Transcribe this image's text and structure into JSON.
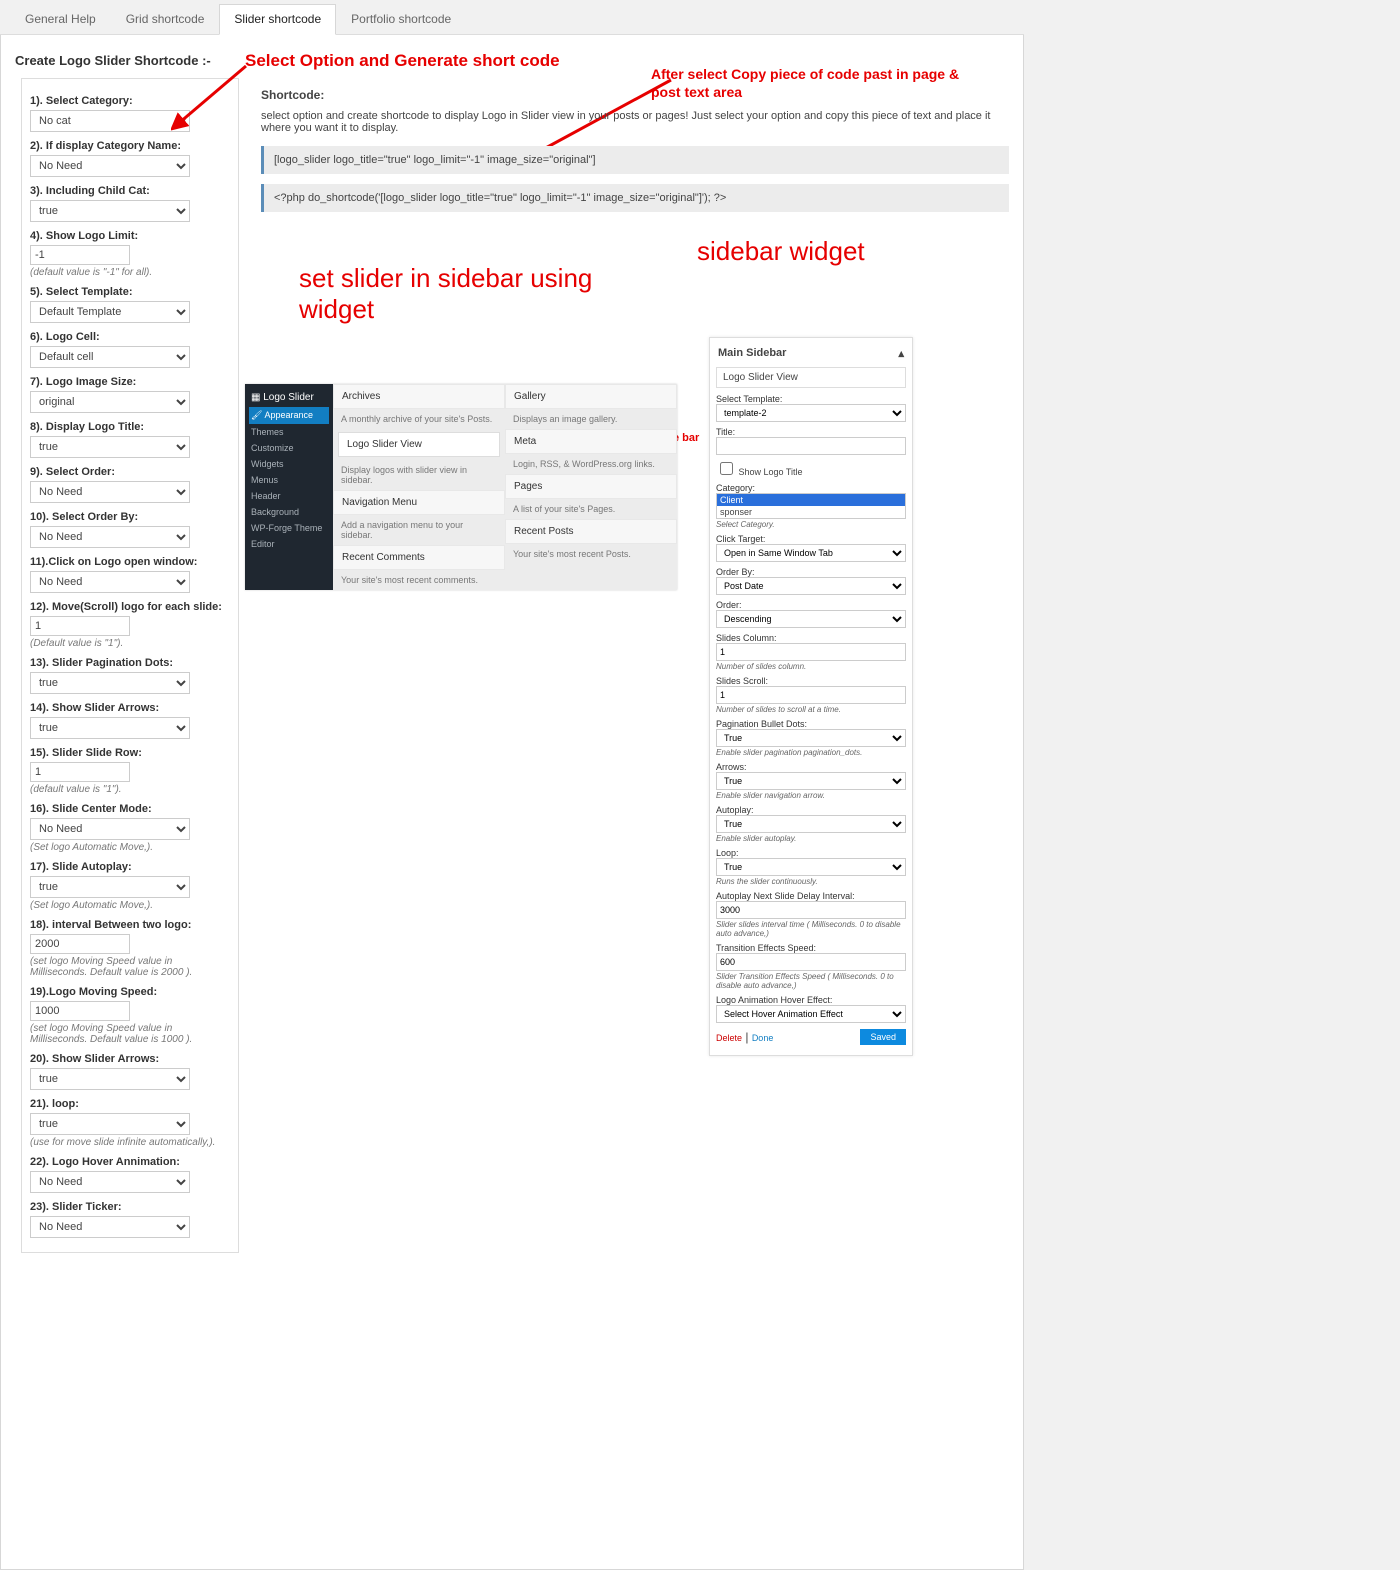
{
  "tabs": {
    "t0": "General Help",
    "t1": "Grid shortcode",
    "t2": "Slider shortcode",
    "t3": "Portfolio shortcode"
  },
  "page_title": "Create Logo Slider Shortcode :-",
  "annotations": {
    "a1": "Select Option and Generate short code",
    "a2": "After select Copy piece of code past in page & post text area",
    "a3": "set slider in sidebar using widget",
    "a4": "sidebar widget",
    "a5": "Select widget for side bar"
  },
  "shortcode_panel": {
    "title": "Shortcode:",
    "desc": "select option and create shortcode to display Logo in Slider view in your posts or pages! Just select your option and copy this piece of text and place it where you want it to display.",
    "code1": "[logo_slider logo_title=\"true\" logo_limit=\"-1\" image_size=\"original\"]",
    "code2": "<?php do_shortcode('[logo_slider logo_title=\"true\" logo_limit=\"-1\" image_size=\"original\"]'); ?>"
  },
  "fields": {
    "f1": {
      "label": "1). Select Category:",
      "value": "No cat",
      "type": "select"
    },
    "f2": {
      "label": "2). If display Category Name:",
      "value": "No Need",
      "type": "select"
    },
    "f3": {
      "label": "3). Including Child Cat:",
      "value": "true",
      "type": "select"
    },
    "f4": {
      "label": "4). Show Logo Limit:",
      "value": "-1",
      "type": "input-small",
      "help": "(default value is \"-1\" for all)."
    },
    "f5": {
      "label": "5). Select Template:",
      "value": "Default Template",
      "type": "select"
    },
    "f6": {
      "label": "6). Logo Cell:",
      "value": "Default cell",
      "type": "select"
    },
    "f7": {
      "label": "7). Logo Image Size:",
      "value": "original",
      "type": "select"
    },
    "f8": {
      "label": "8). Display Logo Title:",
      "value": "true",
      "type": "select"
    },
    "f9": {
      "label": "9). Select Order:",
      "value": "No Need",
      "type": "select"
    },
    "f10": {
      "label": "10). Select Order By:",
      "value": "No Need",
      "type": "select"
    },
    "f11": {
      "label": "11).Click on Logo open window:",
      "value": "No Need",
      "type": "select"
    },
    "f12": {
      "label": "12). Move(Scroll) logo for each slide:",
      "value": "1",
      "type": "input-small",
      "help": "(Default value is \"1\")."
    },
    "f13": {
      "label": "13). Slider Pagination Dots:",
      "value": "true",
      "type": "select"
    },
    "f14": {
      "label": "14). Show Slider Arrows:",
      "value": "true",
      "type": "select"
    },
    "f15": {
      "label": "15). Slider Slide Row:",
      "value": "1",
      "type": "input-small",
      "help": "(default value is \"1\")."
    },
    "f16": {
      "label": "16). Slide Center Mode:",
      "value": "No Need",
      "type": "select",
      "help": "(Set logo Automatic Move,)."
    },
    "f17": {
      "label": "17). Slide Autoplay:",
      "value": "true",
      "type": "select",
      "help": "(Set logo Automatic Move,)."
    },
    "f18": {
      "label": "18). interval Between two logo:",
      "value": "2000",
      "type": "input-small",
      "help": "(set logo Moving Speed value in Milliseconds. Default value is 2000 )."
    },
    "f19": {
      "label": "19).Logo Moving Speed:",
      "value": "1000",
      "type": "input-small",
      "help": "(set logo Moving Speed value in Milliseconds. Default value is 1000 )."
    },
    "f20": {
      "label": "20). Show Slider Arrows:",
      "value": "true",
      "type": "select"
    },
    "f21": {
      "label": "21). loop:",
      "value": "true",
      "type": "select",
      "help": "(use for move slide infinite automatically,)."
    },
    "f22": {
      "label": "22). Logo Hover Annimation:",
      "value": "No Need",
      "type": "select"
    },
    "f23": {
      "label": "23). Slider Ticker:",
      "value": "No Need",
      "type": "select"
    }
  },
  "widget_chooser": {
    "brand": "Logo Slider",
    "side_active": "Appearance",
    "side_items": [
      "Themes",
      "Customize",
      "Widgets",
      "Menus",
      "Header",
      "Background",
      "WP-Forge Theme",
      "Editor"
    ],
    "col1": [
      {
        "h": "Archives",
        "d": "A monthly archive of your site's Posts."
      },
      {
        "h": "Logo Slider View",
        "d": "Display logos with slider view in sidebar.",
        "widget": true
      },
      {
        "h": "Navigation Menu",
        "d": "Add a navigation menu to your sidebar."
      },
      {
        "h": "Recent Comments",
        "d": "Your site's most recent comments."
      }
    ],
    "col2": [
      {
        "h": "Gallery",
        "d": "Displays an image gallery."
      },
      {
        "h": "Meta",
        "d": "Login, RSS, & WordPress.org links."
      },
      {
        "h": "Pages",
        "d": "A list of your site's Pages."
      },
      {
        "h": "Recent Posts",
        "d": "Your site's most recent Posts."
      }
    ]
  },
  "widget_form": {
    "header": "Main Sidebar",
    "sub": "Logo Slider View",
    "template_lbl": "Select Template:",
    "template_val": "template-2",
    "title_lbl": "Title:",
    "title_val": "",
    "show_title": "Show Logo Title",
    "cat_lbl": "Category:",
    "cat_opts": [
      "Client",
      "sponser"
    ],
    "cat_help": "Select Category.",
    "click_lbl": "Click Target:",
    "click_val": "Open in Same Window Tab",
    "orderby_lbl": "Order By:",
    "orderby_val": "Post Date",
    "order_lbl": "Order:",
    "order_val": "Descending",
    "col_lbl": "Slides Column:",
    "col_val": "1",
    "col_help": "Number of slides column.",
    "scroll_lbl": "Slides Scroll:",
    "scroll_val": "1",
    "scroll_help": "Number of slides to scroll at a time.",
    "dots_lbl": "Pagination Bullet Dots:",
    "dots_val": "True",
    "dots_help": "Enable slider pagination pagination_dots.",
    "arrows_lbl": "Arrows:",
    "arrows_val": "True",
    "arrows_help": "Enable slider navigation arrow.",
    "auto_lbl": "Autoplay:",
    "auto_val": "True",
    "auto_help": "Enable slider autoplay.",
    "loop_lbl": "Loop:",
    "loop_val": "True",
    "loop_help": "Runs the slider continuously.",
    "delay_lbl": "Autoplay Next Slide Delay Interval:",
    "delay_val": "3000",
    "delay_help": "Slider slides interval time ( Milliseconds. 0 to disable auto advance,)",
    "speed_lbl": "Transition Effects Speed:",
    "speed_val": "600",
    "speed_help": "Slider Transition Effects Speed ( Milliseconds. 0 to disable auto advance,)",
    "hover_lbl": "Logo Animation Hover Effect:",
    "hover_val": "Select Hover Animation Effect",
    "delete": "Delete",
    "done": "Done",
    "save": "Saved"
  }
}
